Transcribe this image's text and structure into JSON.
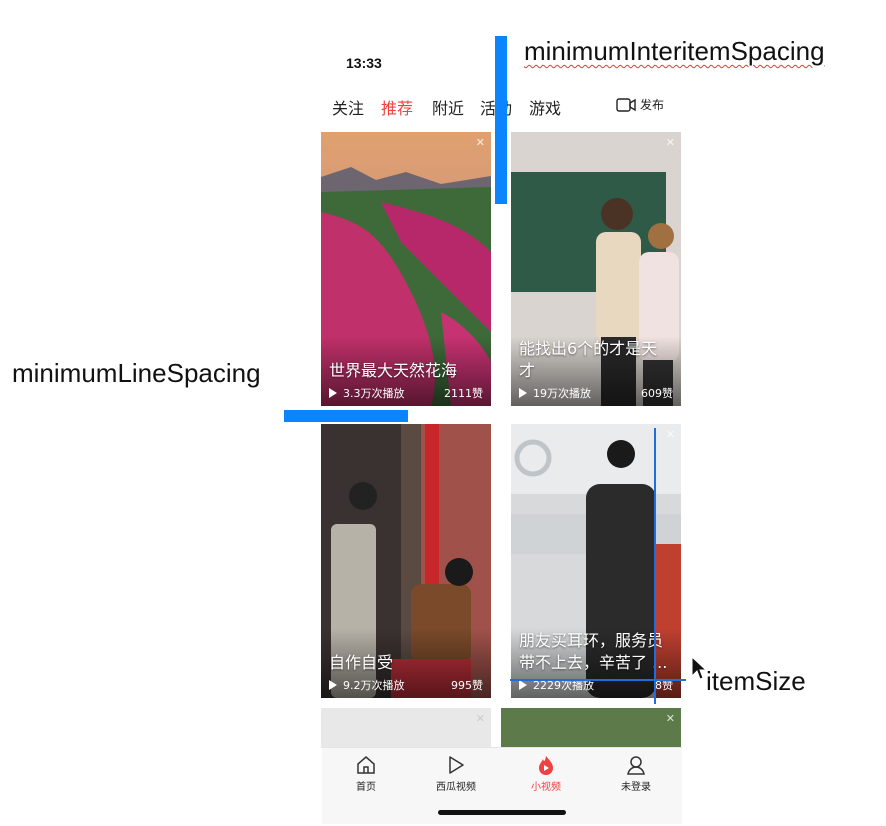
{
  "status_bar": {
    "time": "13:33"
  },
  "top_tabs": [
    {
      "label": "关注",
      "active": false
    },
    {
      "label": "推荐",
      "active": true
    },
    {
      "label": "附近",
      "active": false
    },
    {
      "label": "活动",
      "active": false
    },
    {
      "label": "游戏",
      "active": false
    }
  ],
  "publish": {
    "label": "发布",
    "icon": "video-camera-icon"
  },
  "cards": [
    {
      "title": "世界最大天然花海",
      "plays": "3.3万次播放",
      "likes": "2111赞"
    },
    {
      "title": "能找出6个的才是天才",
      "plays": "19万次播放",
      "likes": "609赞"
    },
    {
      "title": "自作自受",
      "plays": "9.2万次播放",
      "likes": "995赞"
    },
    {
      "title": "朋友买耳环，服务员带不上去，辛苦了 ...",
      "plays": "2229次播放",
      "likes": "8赞"
    }
  ],
  "bottom_tabs": [
    {
      "label": "首页",
      "icon": "home-icon",
      "active": false
    },
    {
      "label": "西瓜视频",
      "icon": "play-outline-icon",
      "active": false
    },
    {
      "label": "小视频",
      "icon": "flame-play-icon",
      "active": true
    },
    {
      "label": "未登录",
      "icon": "user-icon",
      "active": false
    }
  ],
  "annotations": {
    "interitem": "minimumInteritemSpacing",
    "line": "minimumLineSpacing",
    "item_size": "itemSize"
  },
  "colors": {
    "accent": "#f04142",
    "annotation_blue": "#0a84ff"
  }
}
